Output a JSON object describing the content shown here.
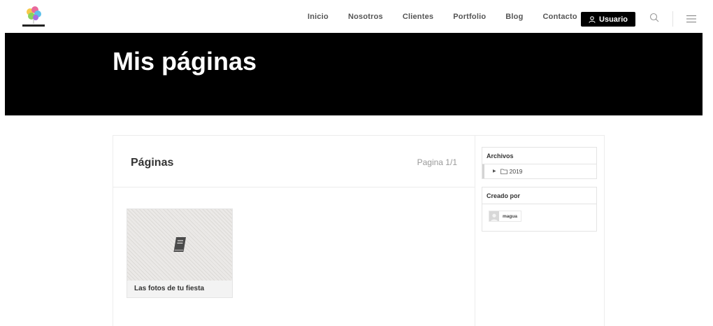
{
  "nav": {
    "items": [
      "Inicio",
      "Nosotros",
      "Clientes",
      "Portfolio",
      "Blog",
      "Contacto"
    ],
    "user_label": "Usuario"
  },
  "icons": {
    "logo": "balloons-logo",
    "search": "search-icon",
    "menu": "hamburger-menu-icon",
    "user": "user-icon",
    "book": "book-icon",
    "folder": "folder-icon"
  },
  "banner": {
    "title": "Mis páginas"
  },
  "panel": {
    "title": "Páginas",
    "pager": "Pagina 1/1",
    "cards": [
      {
        "caption": "Las fotos de tu fiesta"
      }
    ]
  },
  "sidebar": {
    "archive": {
      "title": "Archivos",
      "year": "2019"
    },
    "author": {
      "title": "Creado por",
      "name": "magua"
    }
  },
  "colors": {
    "banner_bg": "#000000",
    "user_button_bg": "#000000",
    "nav_text": "#555555",
    "pager_text": "#999999"
  }
}
